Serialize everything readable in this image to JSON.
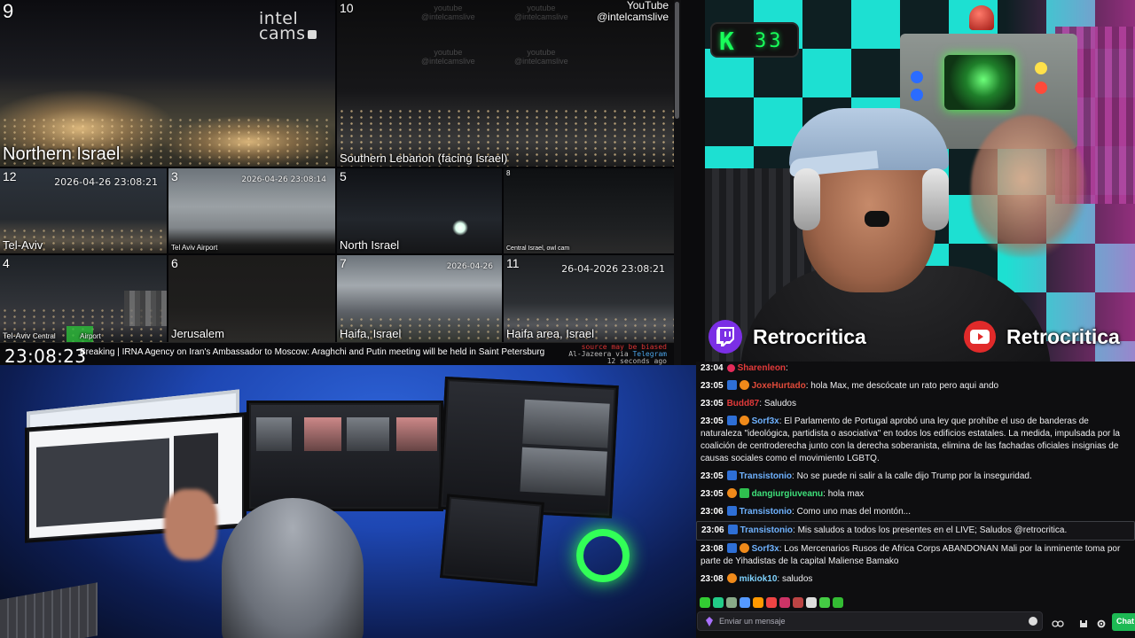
{
  "cams": {
    "c9": {
      "num": "9",
      "label": "Northern Israel"
    },
    "c10": {
      "num": "10",
      "label": "Southern Lebanon (facing Israel)"
    },
    "c12": {
      "num": "12",
      "label": "Tel-Aviv",
      "stamp": "2026-04-26 23:08:21"
    },
    "c3": {
      "num": "3",
      "label": "Tel Aviv Airport",
      "stamp": "2026-04-26 23:08:14"
    },
    "c5": {
      "num": "5",
      "label": "North Israel"
    },
    "c8": {
      "num": "8",
      "label": "Central Israel, owl cam"
    },
    "c4": {
      "num": "4",
      "label": "Tel-Aviv",
      "label2": "Central",
      "label3": "Airport"
    },
    "c6": {
      "num": "6",
      "label": "Jerusalem"
    },
    "c7": {
      "num": "7",
      "label": "Haifa, Israel",
      "stamp": "2026-04-26"
    },
    "c11": {
      "num": "11",
      "label": "Haifa area, Israel",
      "stamp": "26-04-2026 23:08:21"
    }
  },
  "branding": {
    "intel_line1": "intel",
    "intel_line2": "cams",
    "yt_line1": "YouTube",
    "yt_line2": "@intelcamslive",
    "watermark_1": "youtube",
    "watermark_2": "@intelcamslive"
  },
  "ticker": {
    "clock": "23:08:23",
    "text": "Breaking | IRNA Agency on Iran's Ambassador to Moscow: Araghchi and Putin meeting will be held in Saint Petersburg",
    "source_line1": "source may be biased",
    "source_line2_a": "Al-Jazeera via",
    "source_line2_b": "Telegram",
    "source_line3": "12 seconds ago"
  },
  "overlay": {
    "counter_letter": "K",
    "counter_value": "33",
    "twitch_name": "Retrocritica",
    "youtube_name": "Retrocritica"
  },
  "chat": {
    "messages": [
      {
        "time": "23:04",
        "user": "Sharenleon",
        "color": "#e23a3a",
        "text": "",
        "badges": [
          "heart"
        ]
      },
      {
        "time": "23:05",
        "user": "JoxeHurtado",
        "color": "#e04a3a",
        "text": "hola Max, me descócate un rato pero aqui ando",
        "badges": [
          "prime",
          "coin"
        ]
      },
      {
        "time": "23:05",
        "user": "Budd87",
        "color": "#e23a3a",
        "text": "Saludos",
        "badges": []
      },
      {
        "time": "23:05",
        "user": "Sorf3x",
        "color": "#6fb2ff",
        "text": "El Parlamento de Portugal aprobó una ley que prohíbe el uso de banderas de naturaleza \"ideológica, partidista o asociativa\" en todos los edificios estatales. La medida, impulsada por la coalición de centroderecha junto con la derecha soberanista, elimina de las fachadas oficiales insignias de causas sociales como el movimiento LGBTQ.",
        "badges": [
          "prime",
          "coin"
        ]
      },
      {
        "time": "23:05",
        "user": "Transistonio",
        "color": "#6fb2ff",
        "text": "No se puede ni salir a la calle dijo Trump por la inseguridad.",
        "badges": [
          "prime"
        ]
      },
      {
        "time": "23:05",
        "user": "dangiurgiuveanu",
        "color": "#3fe07a",
        "text": "hola max",
        "badges": [
          "coin",
          "gift"
        ]
      },
      {
        "time": "23:06",
        "user": "Transistonio",
        "color": "#6fb2ff",
        "text": "Como uno mas del montón...",
        "badges": [
          "prime"
        ]
      },
      {
        "time": "23:06",
        "user": "Transistonio",
        "color": "#6fb2ff",
        "text": "Mis saludos a todos los presentes en el LIVE; Saludos @retrocritica.",
        "badges": [
          "prime"
        ],
        "highlight": true
      },
      {
        "time": "23:08",
        "user": "Sorf3x",
        "color": "#6fb2ff",
        "text": "Los Mercenarios Rusos de Africa Corps ABANDONAN Mali por la inminente toma por parte de Yihadistas de la capital Maliense Bamako",
        "badges": [
          "prime",
          "coin"
        ]
      },
      {
        "time": "23:08",
        "user": "mikiok10",
        "color": "#7fd3ff",
        "text": "saludos",
        "badges": [
          "coin"
        ]
      }
    ],
    "input_placeholder": "Enviar un mensaje",
    "chat_button": "Chat"
  },
  "colors": {
    "twitch": "#7b2fe5",
    "youtube": "#e12a2a",
    "counter_green": "#18ff5a",
    "chat_bg": "#0e0e10"
  },
  "icons": {
    "twitch": "twitch-icon",
    "youtube": "youtube-icon",
    "emote": "emote-picker-icon",
    "settings": "gear-icon",
    "bits": "bits-icon"
  }
}
